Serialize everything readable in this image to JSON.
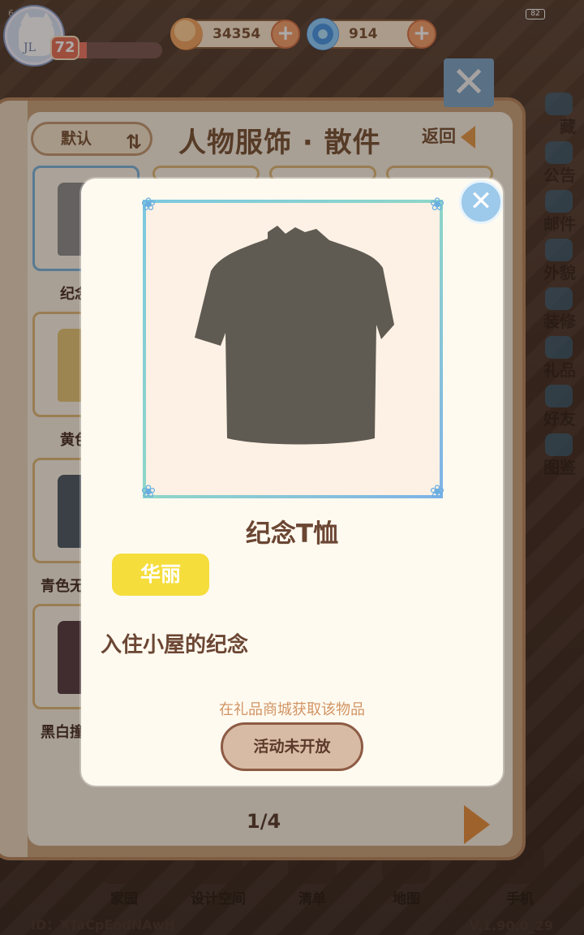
{
  "status": {
    "time": "6:5",
    "battery": "82"
  },
  "player": {
    "initials": "JL",
    "level": "72",
    "xp_fraction": 0.14
  },
  "currencies": [
    {
      "name": "coin",
      "value": "34354",
      "icon": "coin-icon"
    },
    {
      "name": "gem",
      "value": "914",
      "icon": "swirl-icon"
    }
  ],
  "side_menu": [
    {
      "label": "藏",
      "icon": "collection-icon"
    },
    {
      "label": "公告",
      "icon": "notice-icon"
    },
    {
      "label": "邮件",
      "icon": "mail-icon"
    },
    {
      "label": "外貌",
      "icon": "appearance-icon"
    },
    {
      "label": "装修",
      "icon": "decorate-icon"
    },
    {
      "label": "礼品",
      "icon": "gift-icon"
    },
    {
      "label": "好友",
      "icon": "friends-icon"
    },
    {
      "label": "图鉴",
      "icon": "handbook-icon"
    }
  ],
  "bottom_nav": [
    {
      "label": "家园",
      "icon": "home-icon"
    },
    {
      "label": "设计空间",
      "icon": "design-icon"
    },
    {
      "label": "清单",
      "icon": "list-icon"
    },
    {
      "label": "地图",
      "icon": "map-icon"
    },
    {
      "label": "手机",
      "icon": "phone-icon"
    }
  ],
  "footer": {
    "player_id": "ID：XTaCpEodNAwH",
    "version": "V.1.90.0_29"
  },
  "wardrobe": {
    "sort_label": "默认",
    "title": "人物服饰 · 散件",
    "back_label": "返回",
    "items": [
      {
        "label": "纪念",
        "color": "#8f8f8f"
      },
      {
        "label": "黄色",
        "color": "#e6c77a"
      },
      {
        "label": "青色无",
        "color": "#4f5c66"
      },
      {
        "label": "黑白撞",
        "color": "#5a3f45"
      }
    ],
    "page": "1/4"
  },
  "detail": {
    "item_name": "纪念T恤",
    "rarity": "华丽",
    "description": "入住小屋的纪念",
    "source_hint": "在礼品商城获取该物品",
    "action_label": "活动未开放",
    "colors": {
      "shirt": "#5f5a52",
      "rarity_bg": "#f5dd3c",
      "frame": "#7cc8e0"
    }
  }
}
